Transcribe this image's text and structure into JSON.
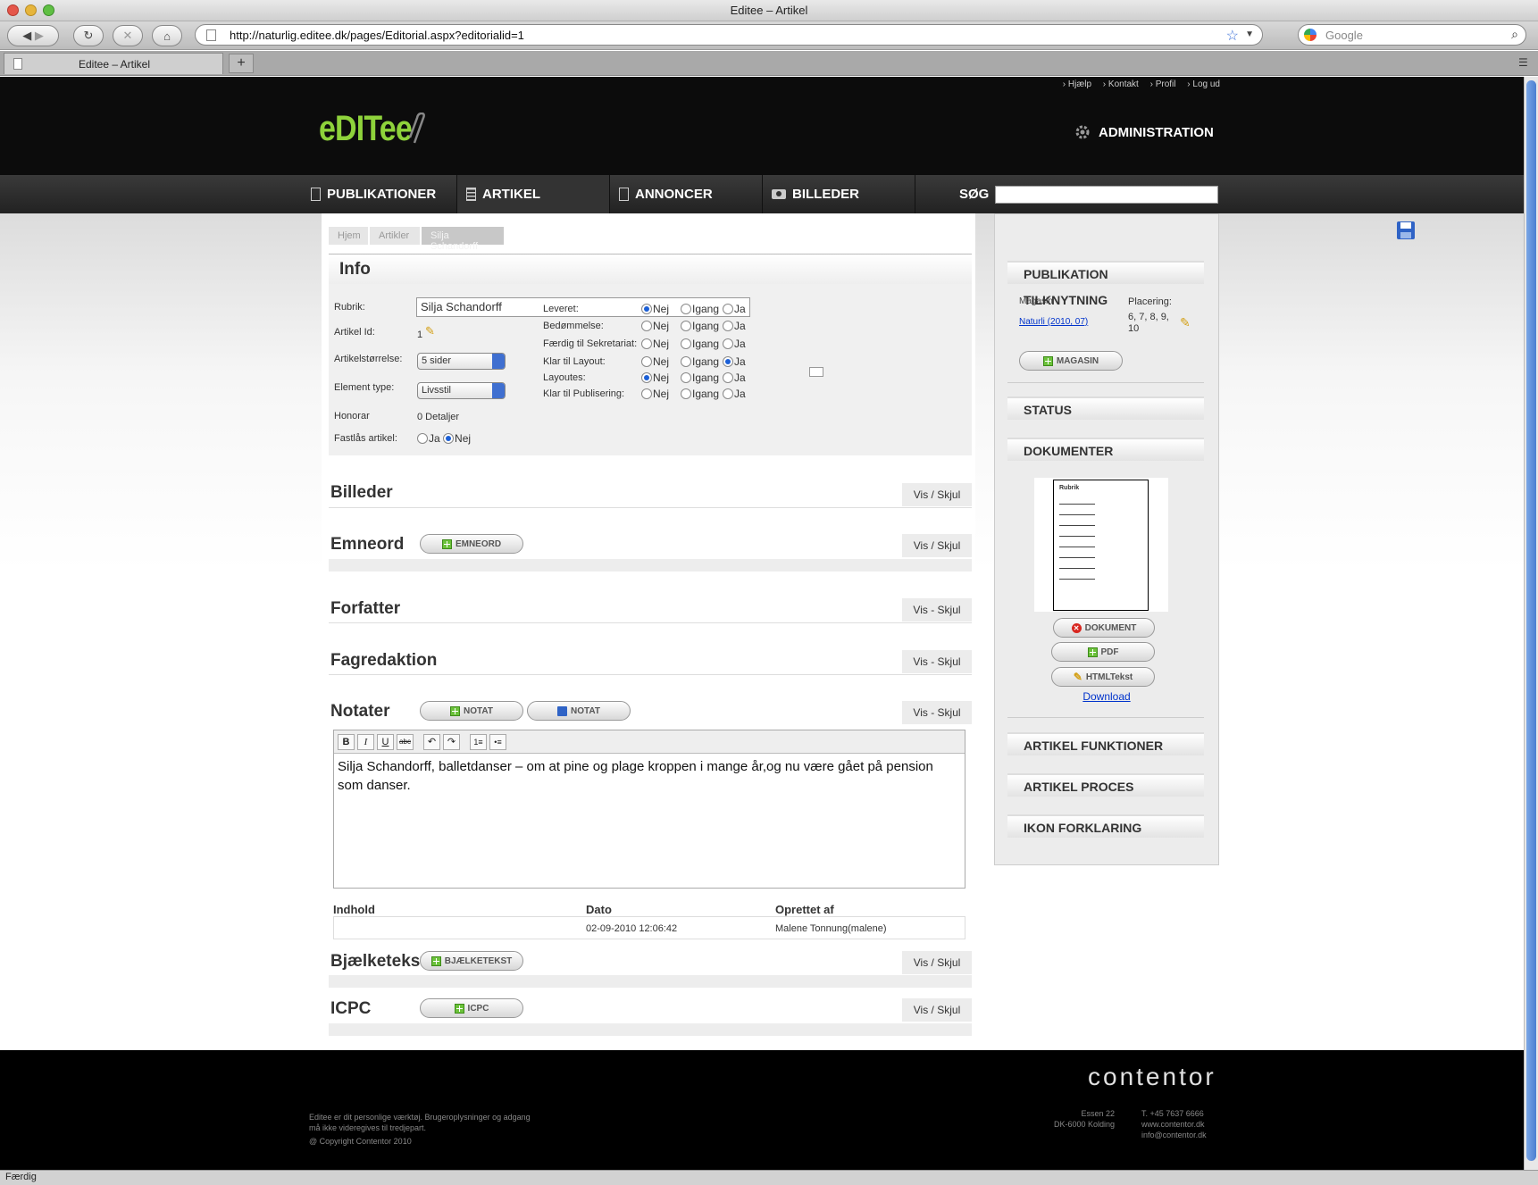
{
  "browser": {
    "window_title": "Editee – Artikel",
    "url": "http://naturlig.editee.dk/pages/Editorial.aspx?editorialid=1",
    "search_placeholder": "Google",
    "tab_label": "Editee – Artikel",
    "new_tab": "+",
    "status": "Færdig"
  },
  "header": {
    "top_links": [
      "› Hjælp",
      "› Kontakt",
      "› Profil",
      "› Log ud"
    ],
    "logo": "eDITee",
    "admin": "ADMINISTRATION"
  },
  "nav": {
    "items": [
      "PUBLIKATIONER",
      "ARTIKEL",
      "ANNONCER",
      "BILLEDER"
    ],
    "search_label": "SØG"
  },
  "breadcrumb": [
    "Hjem",
    "Artikler",
    "Silja Schandorff"
  ],
  "info": {
    "title": "Info",
    "rubrik_label": "Rubrik:",
    "rubrik_value": "Silja Schandorff",
    "artikel_id_label": "Artikel Id:",
    "artikel_id_value": "1",
    "size_label": "Artikelstørrelse:",
    "size_value": "5 sider",
    "element_label": "Element type:",
    "element_value": "Livsstil",
    "honorar_label": "Honorar",
    "honorar_value": "0 Detaljer",
    "fastlaas_label": "Fastlås artikel:",
    "fastlaas_ja": "Ja",
    "fastlaas_nej": "Nej",
    "status_rows": [
      {
        "label": "Leveret:",
        "selected": "Nej"
      },
      {
        "label": "Bedømmelse:",
        "selected": ""
      },
      {
        "label": "Færdig til Sekretariat:",
        "selected": ""
      },
      {
        "label": "Klar til Layout:",
        "selected": "Ja"
      },
      {
        "label": "Layoutes:",
        "selected": "Nej"
      },
      {
        "label": "Klar til Publisering:",
        "selected": ""
      }
    ],
    "opt_nej": "Nej",
    "opt_igang": "Igang",
    "opt_ja": "Ja"
  },
  "sections": {
    "billeder": "Billeder",
    "emneord": "Emneord",
    "emneord_btn": "EMNEORD",
    "forfatter": "Forfatter",
    "fagredaktion": "Fagredaktion",
    "notater": "Notater",
    "notat_add": "NOTAT",
    "notat_save": "NOTAT",
    "bjaelketekst": "Bjælketekst",
    "bjaelketekst_btn": "BJÆLKETEKST",
    "icpc": "ICPC",
    "icpc_btn": "ICPC",
    "vis_skjul": "Vis / Skjul",
    "vis_skjul_dash": "Vis - Skjul"
  },
  "editor": {
    "text": "Silja Schandorff, balletdanser – om at pine og plage kroppen i mange år,og nu være gået på pension som danser.",
    "toolbar": [
      "B",
      "I",
      "U",
      "abc",
      "↶",
      "↷",
      "1≡",
      "•≡"
    ]
  },
  "notes_table": {
    "headers": [
      "Indhold",
      "Dato",
      "Oprettet af"
    ],
    "rows": [
      [
        "",
        "02-09-2010 12:06:42",
        "Malene Tonnung(malene)"
      ]
    ]
  },
  "sidebar": {
    "publikation": "PUBLIKATION",
    "tilknytning": "TILKNYTNING",
    "magasin_label": "Magasin",
    "magasin_link": "Naturli (2010, 07)",
    "placering_label": "Placering:",
    "placering_value": "6, 7, 8, 9, 10",
    "magasin_btn": "MAGASIN",
    "status": "STATUS",
    "dokumenter": "DOKUMENTER",
    "doc_thumb_title": "Rubrik",
    "doc_btn": "DOKUMENT",
    "pdf_btn": "PDF",
    "html_btn": "HTMLTekst",
    "download": "Download",
    "artikel_funktioner": "ARTIKEL FUNKTIONER",
    "artikel_proces": "ARTIKEL PROCES",
    "ikon_forklaring": "IKON FORKLARING"
  },
  "footer": {
    "brand": "contentor",
    "disclaimer_1": "Editee er dit personlige værktøj. Brugeroplysninger og adgang",
    "disclaimer_2": "må ikke videregives til tredjepart.",
    "copyright": "@ Copyright Contentor 2010",
    "address_1": "Essen 22",
    "address_2": "DK-6000 Kolding",
    "phone": "T. +45 7637 6666",
    "web": "www.contentor.dk",
    "email": "info@contentor.dk"
  },
  "colors": {
    "brand_green": "#8ed23b",
    "header_bg": "#0c0c0c",
    "link_blue": "#0033cc"
  }
}
